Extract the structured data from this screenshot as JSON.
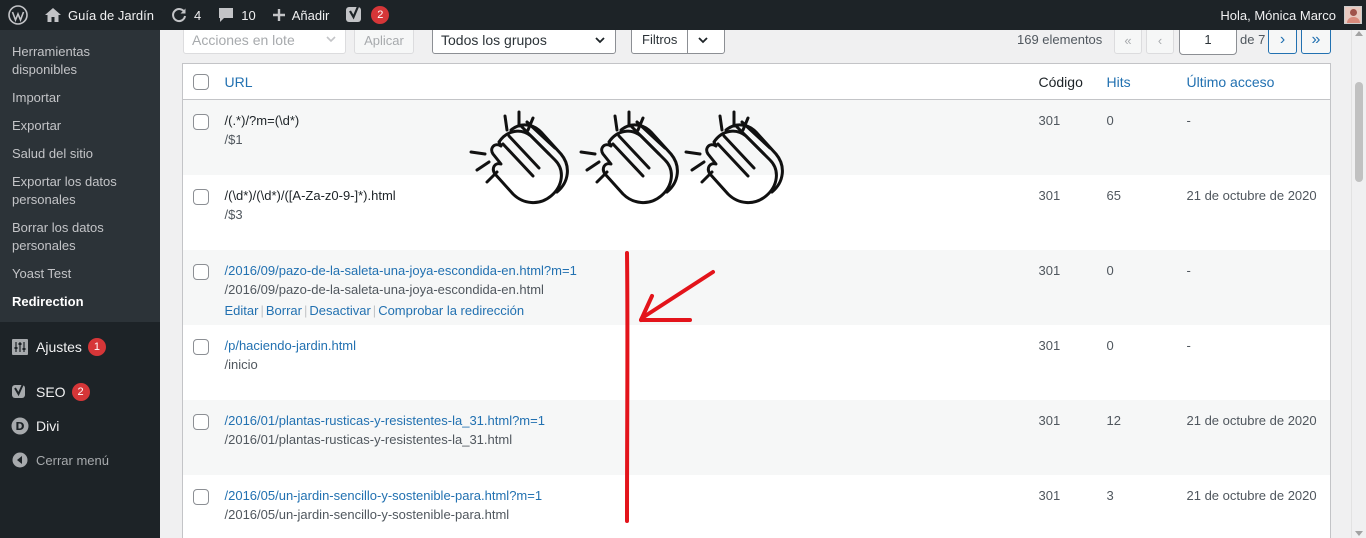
{
  "adminbar": {
    "site_name": "Guía de Jardín",
    "updates_count": "4",
    "comments_count": "10",
    "add_new_label": "Añadir",
    "yoast_badge": "2",
    "greeting": "Hola, Mónica Marco"
  },
  "sidebar": {
    "submenu": [
      {
        "label": "Herramientas disponibles"
      },
      {
        "label": "Importar"
      },
      {
        "label": "Exportar"
      },
      {
        "label": "Salud del sitio"
      },
      {
        "label": "Exportar los datos personales"
      },
      {
        "label": "Borrar los datos personales"
      },
      {
        "label": "Yoast Test"
      },
      {
        "label": "Redirection"
      }
    ],
    "menu": [
      {
        "label": "Ajustes",
        "badge": "1"
      },
      {
        "label": "SEO",
        "badge": "2"
      },
      {
        "label": "Divi"
      }
    ],
    "collapse_label": "Cerrar menú"
  },
  "toolbar": {
    "bulk_actions": "Acciones en lote",
    "apply": "Aplicar",
    "groups": "Todos los grupos",
    "filters": "Filtros",
    "items_count": "169 elementos",
    "first_page": "«",
    "prev_page": "‹",
    "current_page": "1",
    "of_pages": "de 7",
    "next_page": "›",
    "last_page": "»"
  },
  "table": {
    "headers": {
      "url": "URL",
      "code": "Código",
      "hits": "Hits",
      "last_access": "Último acceso"
    },
    "rows": [
      {
        "source": "/(.*)/?m=(\\d*)",
        "target": "/$1",
        "code": "301",
        "hits": "0",
        "last": "-"
      },
      {
        "source": "/(\\d*)/(\\d*)/([A-Za-z0-9-]*).html",
        "target": "/$3",
        "code": "301",
        "hits": "65",
        "last": "21 de octubre de 2020"
      },
      {
        "source": "/2016/09/pazo-de-la-saleta-una-joya-escondida-en.html?m=1",
        "target": "/2016/09/pazo-de-la-saleta-una-joya-escondida-en.html",
        "code": "301",
        "hits": "0",
        "last": "-",
        "actions": {
          "edit": "Editar",
          "delete": "Borrar",
          "disable": "Desactivar",
          "check": "Comprobar la redirección"
        }
      },
      {
        "source": "/p/haciendo-jardin.html",
        "target": "/inicio",
        "code": "301",
        "hits": "0",
        "last": "-"
      },
      {
        "source": "/2016/01/plantas-rusticas-y-resistentes-la_31.html?m=1",
        "target": "/2016/01/plantas-rusticas-y-resistentes-la_31.html",
        "code": "301",
        "hits": "12",
        "last": "21 de octubre de 2020"
      },
      {
        "source": "/2016/05/un-jardin-sencillo-y-sostenible-para.html?m=1",
        "target": "/2016/05/un-jardin-sencillo-y-sostenible-para.html",
        "code": "301",
        "hits": "3",
        "last": "21 de octubre de 2020"
      }
    ]
  },
  "annotations": {
    "clap_icon": "clapping-hands-icon",
    "marker_color": "#e3141b"
  },
  "colors": {
    "admin_bar": "#1d2327",
    "link": "#2271b1",
    "badge": "#d63638"
  }
}
